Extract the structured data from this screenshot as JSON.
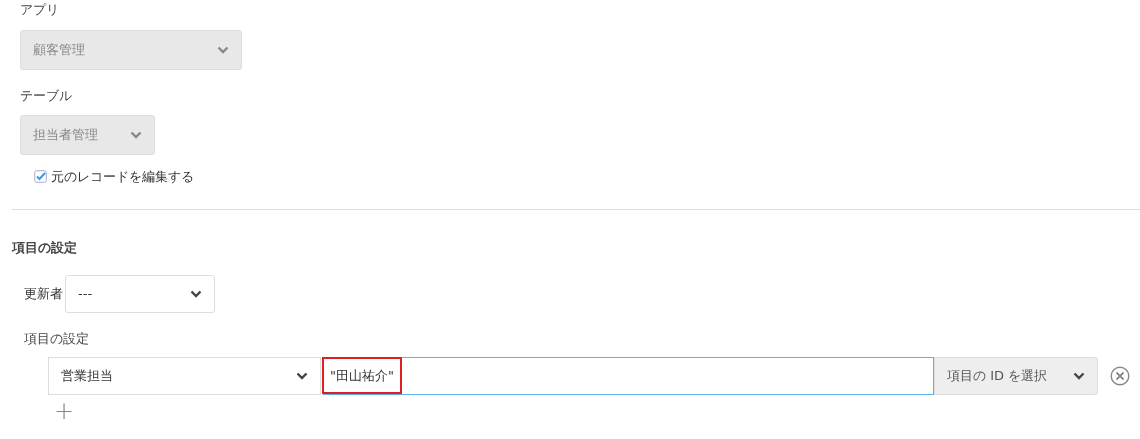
{
  "app": {
    "label": "アプリ",
    "value": "顧客管理",
    "disabled": true
  },
  "table": {
    "label": "テーブル",
    "value": "担当者管理",
    "disabled": true
  },
  "edit_original": {
    "label": "元のレコードを編集する",
    "checked": true
  },
  "section_title": "項目の設定",
  "updater": {
    "label": "更新者",
    "value": "---"
  },
  "fields_label": "項目の設定",
  "field_rows": [
    {
      "field": "営業担当",
      "value": "\"田山祐介\"",
      "highlighted": true,
      "id_select": "項目の ID を選択"
    }
  ],
  "add_button": "+"
}
